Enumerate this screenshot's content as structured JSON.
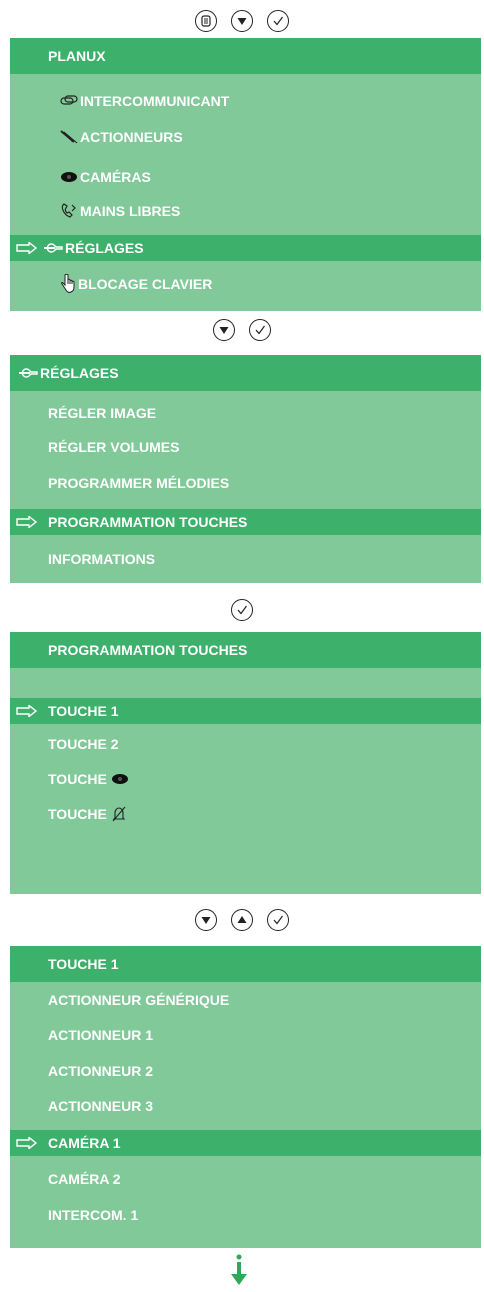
{
  "section1": {
    "title": "PLANUX",
    "items": [
      {
        "label": "INTERCOMMUNICANT",
        "icon": "intercom-icon"
      },
      {
        "label": "ACTIONNEURS",
        "icon": "actuator-icon"
      },
      {
        "label": "CAMÉRAS",
        "icon": "eye-icon"
      },
      {
        "label": "MAINS LIBRES",
        "icon": "handsfree-phone-icon"
      },
      {
        "label": "RÉGLAGES",
        "icon": "wrench-icon",
        "selected": true
      },
      {
        "label": "BLOCAGE CLAVIER",
        "icon": "finger-icon"
      }
    ]
  },
  "section2": {
    "title": "RÉGLAGES",
    "items": [
      {
        "label": "RÉGLER IMAGE"
      },
      {
        "label": "RÉGLER VOLUMES"
      },
      {
        "label": "PROGRAMMER MÉLODIES"
      },
      {
        "label": "PROGRAMMATION TOUCHES",
        "selected": true
      },
      {
        "label": "INFORMATIONS"
      }
    ]
  },
  "section3": {
    "title": "PROGRAMMATION TOUCHES",
    "items": [
      {
        "label": "TOUCHE 1",
        "selected": true
      },
      {
        "label": "TOUCHE 2"
      },
      {
        "label": "TOUCHE"
      },
      {
        "label": "TOUCHE"
      }
    ]
  },
  "section4": {
    "title": "TOUCHE 1",
    "items": [
      {
        "label": "ACTIONNEUR GÉNÉRIQUE"
      },
      {
        "label": "ACTIONNEUR 1"
      },
      {
        "label": "ACTIONNEUR 2"
      },
      {
        "label": "ACTIONNEUR 3"
      },
      {
        "label": "CAMÉRA 1",
        "selected": true
      },
      {
        "label": "CAMÉRA 2"
      },
      {
        "label": "INTERCOM. 1"
      }
    ]
  },
  "colors": {
    "title_bar": "#3db06b",
    "screen_bg": "#82c99a",
    "text": "#ffffff"
  }
}
